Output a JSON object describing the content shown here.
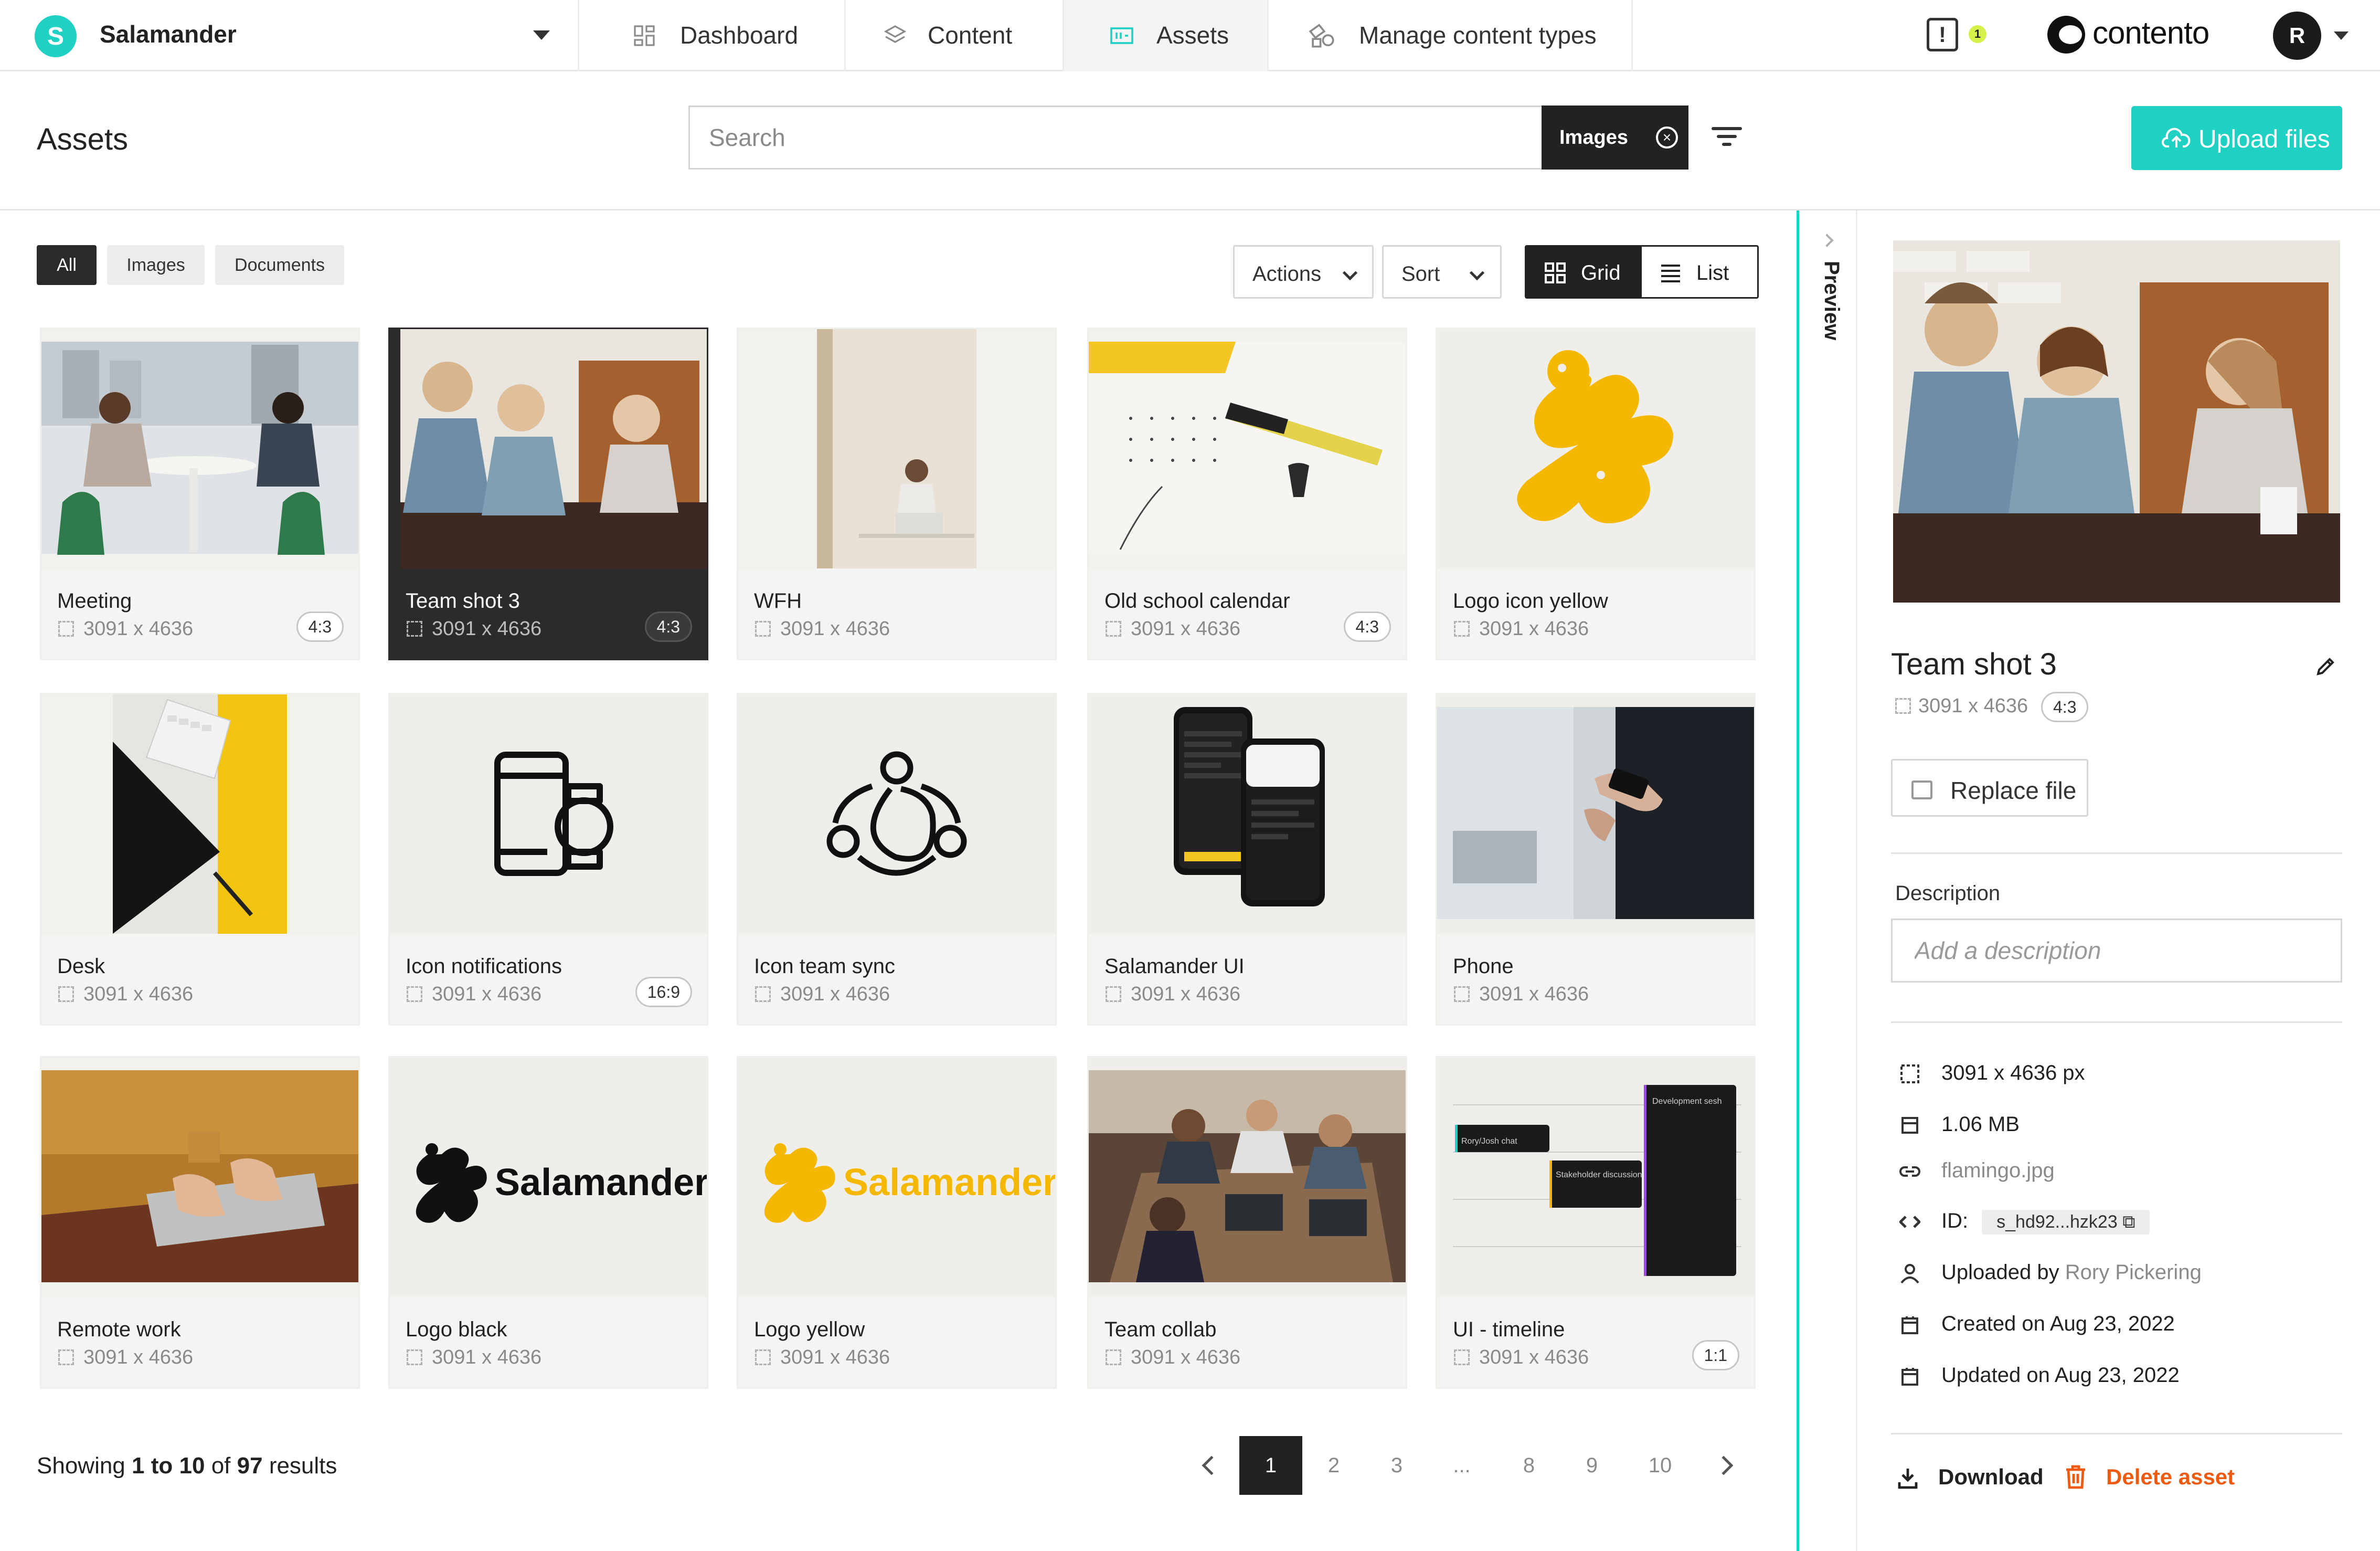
{
  "app": {
    "workspace": "Salamander",
    "workspace_initial": "S",
    "brand": "contento",
    "user_initial": "R",
    "notifications_count": "1",
    "accent_color": "#1fd1c2",
    "danger_color": "#ee5a10"
  },
  "nav": {
    "tabs": [
      {
        "label": "Dashboard",
        "icon": "dashboard-icon",
        "active": false
      },
      {
        "label": "Content",
        "icon": "layers-icon",
        "active": false
      },
      {
        "label": "Assets",
        "icon": "image-icon",
        "active": true
      },
      {
        "label": "Manage content types",
        "icon": "shapes-icon",
        "active": false
      }
    ]
  },
  "header": {
    "title": "Assets",
    "search_placeholder": "Search",
    "search_chip": "Images",
    "upload_label": "Upload files"
  },
  "filters": {
    "chips": [
      {
        "label": "All",
        "active": true
      },
      {
        "label": "Images",
        "active": false
      },
      {
        "label": "Documents",
        "active": false
      }
    ],
    "actions_label": "Actions",
    "sort_label": "Sort",
    "view_grid": "Grid",
    "view_list": "List",
    "active_view": "Grid"
  },
  "assets": [
    {
      "name": "Meeting",
      "dims": "3091 x 4636",
      "ratio": "4:3"
    },
    {
      "name": "Team shot 3",
      "dims": "3091 x 4636",
      "ratio": "4:3",
      "selected": true
    },
    {
      "name": "WFH",
      "dims": "3091 x 4636",
      "ratio": ""
    },
    {
      "name": "Old school calendar",
      "dims": "3091 x 4636",
      "ratio": "4:3"
    },
    {
      "name": "Logo icon yellow",
      "dims": "3091 x 4636",
      "ratio": ""
    },
    {
      "name": "Desk",
      "dims": "3091 x 4636",
      "ratio": ""
    },
    {
      "name": "Icon notifications",
      "dims": "3091 x 4636",
      "ratio": "16:9"
    },
    {
      "name": "Icon team sync",
      "dims": "3091 x 4636",
      "ratio": ""
    },
    {
      "name": "Salamander UI",
      "dims": "3091 x 4636",
      "ratio": ""
    },
    {
      "name": "Phone",
      "dims": "3091 x 4636",
      "ratio": ""
    },
    {
      "name": "Remote work",
      "dims": "3091 x 4636",
      "ratio": ""
    },
    {
      "name": "Logo black",
      "dims": "3091 x 4636",
      "ratio": ""
    },
    {
      "name": "Logo yellow",
      "dims": "3091 x 4636",
      "ratio": ""
    },
    {
      "name": "Team collab",
      "dims": "3091 x 4636",
      "ratio": ""
    },
    {
      "name": "UI - timeline",
      "dims": "3091 x 4636",
      "ratio": "1:1"
    }
  ],
  "thumb_text": {
    "logo_wordmark": "Salamander",
    "timeline_dev": "Development sesh",
    "timeline_stakeholder": "Stakeholder discussion",
    "timeline_chat": "Rory/Josh chat"
  },
  "pagination": {
    "showing_prefix": "Showing",
    "range_from": "1",
    "to_word": "to",
    "range_to": "10",
    "of_word": "of",
    "total": "97",
    "results_word": "results",
    "pages": [
      "1",
      "2",
      "3",
      "...",
      "8",
      "9",
      "10"
    ],
    "current_page": "1"
  },
  "preview": {
    "rail_label": "Preview",
    "title": "Team shot 3",
    "dims": "3091 x 4636",
    "ratio": "4:3",
    "replace_label": "Replace file",
    "description_label": "Description",
    "description_placeholder": "Add a description",
    "size_px": "3091 x 4636 px",
    "file_size": "1.06 MB",
    "filename": "flamingo.jpg",
    "id_label": "ID:",
    "id_value": "s_hd92...hzk23",
    "uploaded_prefix": "Uploaded by",
    "uploaded_by": "Rory Pickering",
    "created": "Created on Aug 23, 2022",
    "updated": "Updated on Aug 23, 2022",
    "download_label": "Download",
    "delete_label": "Delete asset"
  }
}
